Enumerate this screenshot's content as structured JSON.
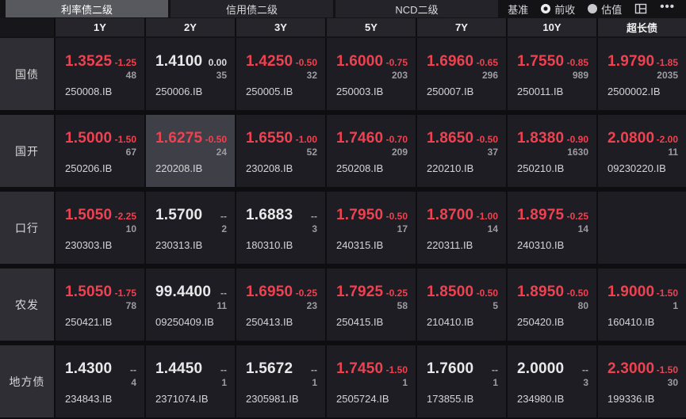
{
  "tabs": [
    {
      "label": "利率债二级",
      "active": true
    },
    {
      "label": "信用债二级",
      "active": false
    },
    {
      "label": "NCD二级",
      "active": false
    }
  ],
  "benchmark": {
    "label": "基准",
    "options": [
      {
        "label": "前收",
        "selected": true
      },
      {
        "label": "估值",
        "selected": false
      }
    ]
  },
  "toolbar_icons": [
    {
      "name": "layout-icon"
    },
    {
      "name": "more-icon",
      "glyph": "•••"
    }
  ],
  "columns": [
    "",
    "1Y",
    "2Y",
    "3Y",
    "5Y",
    "7Y",
    "10Y",
    "超长债"
  ],
  "colors": {
    "up_down_red": "#f04150",
    "neutral_white": "#e9e9eb",
    "muted_gray": "#a8a8ae",
    "highlight_bg": "#3f3f47"
  },
  "rows": [
    {
      "label": "国债",
      "cells": [
        {
          "rate": "1.3525",
          "rate_color": "red",
          "chg": "-1.25",
          "chg_color": "red",
          "vol": "48",
          "code": "250008.IB"
        },
        {
          "rate": "1.4100",
          "rate_color": "white",
          "chg": "0.00",
          "chg_color": "white",
          "vol": "35",
          "code": "250006.IB"
        },
        {
          "rate": "1.4250",
          "rate_color": "red",
          "chg": "-0.50",
          "chg_color": "red",
          "vol": "32",
          "code": "250005.IB"
        },
        {
          "rate": "1.6000",
          "rate_color": "red",
          "chg": "-0.75",
          "chg_color": "red",
          "vol": "203",
          "code": "250003.IB"
        },
        {
          "rate": "1.6960",
          "rate_color": "red",
          "chg": "-0.65",
          "chg_color": "red",
          "vol": "296",
          "code": "250007.IB"
        },
        {
          "rate": "1.7550",
          "rate_color": "red",
          "chg": "-0.85",
          "chg_color": "red",
          "vol": "989",
          "code": "250011.IB"
        },
        {
          "rate": "1.9790",
          "rate_color": "red",
          "chg": "-1.85",
          "chg_color": "red",
          "vol": "2035",
          "code": "2500002.IB"
        }
      ]
    },
    {
      "label": "国开",
      "cells": [
        {
          "rate": "1.5000",
          "rate_color": "red",
          "chg": "-1.50",
          "chg_color": "red",
          "vol": "67",
          "code": "250206.IB"
        },
        {
          "rate": "1.6275",
          "rate_color": "red",
          "chg": "-0.50",
          "chg_color": "red",
          "vol": "24",
          "code": "220208.IB",
          "highlight": true
        },
        {
          "rate": "1.6550",
          "rate_color": "red",
          "chg": "-1.00",
          "chg_color": "red",
          "vol": "52",
          "code": "230208.IB"
        },
        {
          "rate": "1.7460",
          "rate_color": "red",
          "chg": "-0.70",
          "chg_color": "red",
          "vol": "209",
          "code": "250208.IB"
        },
        {
          "rate": "1.8650",
          "rate_color": "red",
          "chg": "-0.50",
          "chg_color": "red",
          "vol": "37",
          "code": "220210.IB"
        },
        {
          "rate": "1.8380",
          "rate_color": "red",
          "chg": "-0.90",
          "chg_color": "red",
          "vol": "1630",
          "code": "250210.IB"
        },
        {
          "rate": "2.0800",
          "rate_color": "red",
          "chg": "-2.00",
          "chg_color": "red",
          "vol": "11",
          "code": "09230220.IB"
        }
      ]
    },
    {
      "label": "口行",
      "cells": [
        {
          "rate": "1.5050",
          "rate_color": "red",
          "chg": "-2.25",
          "chg_color": "red",
          "vol": "10",
          "code": "230303.IB"
        },
        {
          "rate": "1.5700",
          "rate_color": "white",
          "chg": "--",
          "chg_color": "gray",
          "vol": "2",
          "code": "230313.IB"
        },
        {
          "rate": "1.6883",
          "rate_color": "white",
          "chg": "--",
          "chg_color": "gray",
          "vol": "3",
          "code": "180310.IB"
        },
        {
          "rate": "1.7950",
          "rate_color": "red",
          "chg": "-0.50",
          "chg_color": "red",
          "vol": "17",
          "code": "240315.IB"
        },
        {
          "rate": "1.8700",
          "rate_color": "red",
          "chg": "-1.00",
          "chg_color": "red",
          "vol": "14",
          "code": "220311.IB"
        },
        {
          "rate": "1.8975",
          "rate_color": "red",
          "chg": "-0.25",
          "chg_color": "red",
          "vol": "14",
          "code": "240310.IB"
        },
        {}
      ]
    },
    {
      "label": "农发",
      "cells": [
        {
          "rate": "1.5050",
          "rate_color": "red",
          "chg": "-1.75",
          "chg_color": "red",
          "vol": "78",
          "code": "250421.IB"
        },
        {
          "rate": "99.4400",
          "rate_color": "white",
          "chg": "--",
          "chg_color": "gray",
          "vol": "11",
          "code": "09250409.IB"
        },
        {
          "rate": "1.6950",
          "rate_color": "red",
          "chg": "-0.25",
          "chg_color": "red",
          "vol": "23",
          "code": "250413.IB"
        },
        {
          "rate": "1.7925",
          "rate_color": "red",
          "chg": "-0.25",
          "chg_color": "red",
          "vol": "58",
          "code": "250415.IB"
        },
        {
          "rate": "1.8500",
          "rate_color": "red",
          "chg": "-0.50",
          "chg_color": "red",
          "vol": "5",
          "code": "210410.IB"
        },
        {
          "rate": "1.8950",
          "rate_color": "red",
          "chg": "-0.50",
          "chg_color": "red",
          "vol": "80",
          "code": "250420.IB"
        },
        {
          "rate": "1.9000",
          "rate_color": "red",
          "chg": "-1.50",
          "chg_color": "red",
          "vol": "1",
          "code": "160410.IB"
        }
      ]
    },
    {
      "label": "地方债",
      "cells": [
        {
          "rate": "1.4300",
          "rate_color": "white",
          "chg": "--",
          "chg_color": "gray",
          "vol": "4",
          "code": "234843.IB"
        },
        {
          "rate": "1.4450",
          "rate_color": "white",
          "chg": "--",
          "chg_color": "gray",
          "vol": "1",
          "code": "2371074.IB"
        },
        {
          "rate": "1.5672",
          "rate_color": "white",
          "chg": "--",
          "chg_color": "gray",
          "vol": "1",
          "code": "2305981.IB"
        },
        {
          "rate": "1.7450",
          "rate_color": "red",
          "chg": "-1.50",
          "chg_color": "red",
          "vol": "1",
          "code": "2505724.IB"
        },
        {
          "rate": "1.7600",
          "rate_color": "white",
          "chg": "--",
          "chg_color": "gray",
          "vol": "1",
          "code": "173855.IB"
        },
        {
          "rate": "2.0000",
          "rate_color": "white",
          "chg": "--",
          "chg_color": "gray",
          "vol": "3",
          "code": "234980.IB"
        },
        {
          "rate": "2.3000",
          "rate_color": "red",
          "chg": "-1.50",
          "chg_color": "red",
          "vol": "30",
          "code": "199336.IB"
        }
      ]
    }
  ]
}
